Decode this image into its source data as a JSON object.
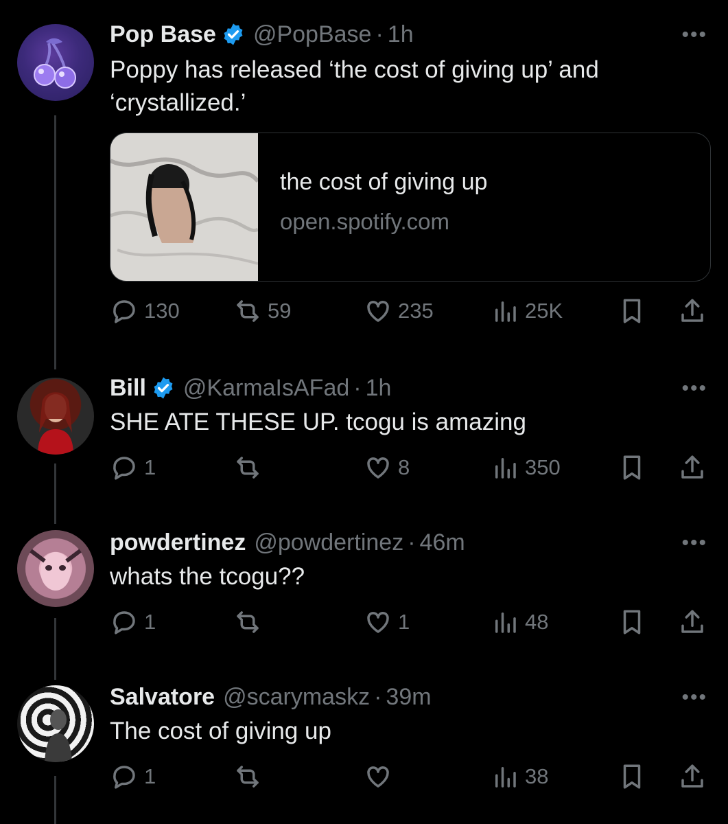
{
  "colors": {
    "background": "#000000",
    "text": "#e7e9ea",
    "muted": "#71767b",
    "verified": "#1d9bf0",
    "divider": "#333639"
  },
  "tweets": [
    {
      "name": "Pop Base",
      "verified": true,
      "handle": "@PopBase",
      "separator": "·",
      "time": "1h",
      "text": "Poppy has released ‘the cost of giving up’ and ‘crystallized.’",
      "card": {
        "title": "the cost of giving up",
        "domain": "open.spotify.com"
      },
      "replies": "130",
      "reposts": "59",
      "likes": "235",
      "views": "25K"
    },
    {
      "name": "Bill",
      "verified": true,
      "handle": "@KarmaIsAFad",
      "separator": "·",
      "time": "1h",
      "text": "SHE ATE THESE UP. tcogu is amazing",
      "replies": "1",
      "reposts": "",
      "likes": "8",
      "views": "350"
    },
    {
      "name": "powdertinez",
      "verified": false,
      "handle": "@powdertinez",
      "separator": "·",
      "time": "46m",
      "text": "whats the tcogu??",
      "replies": "1",
      "reposts": "",
      "likes": "1",
      "views": "48"
    },
    {
      "name": "Salvatore",
      "verified": false,
      "handle": "@scarymaskz",
      "separator": "·",
      "time": "39m",
      "text": "The cost of giving up",
      "replies": "1",
      "reposts": "",
      "likes": "",
      "views": "38"
    }
  ],
  "icons": [
    "cherry-avatar-icon",
    "verified-icon",
    "more-icon",
    "reply-icon",
    "repost-icon",
    "like-icon",
    "views-icon",
    "bookmark-icon",
    "share-icon"
  ]
}
